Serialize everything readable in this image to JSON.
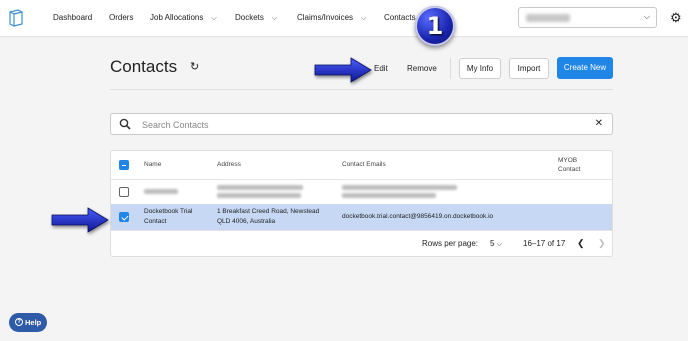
{
  "header": {
    "nav": [
      {
        "label": "Dashboard"
      },
      {
        "label": "Orders"
      },
      {
        "label": "Job Allocations"
      },
      {
        "label": "Dockets"
      },
      {
        "label": "Claims/Invoices"
      },
      {
        "label": "Contacts"
      }
    ],
    "business_select": {
      "value": "Plus Business"
    }
  },
  "annotation": {
    "step_number": "1"
  },
  "page": {
    "title": "Contacts",
    "actions": {
      "edit": "Edit",
      "remove": "Remove",
      "my_info": "My Info",
      "import": "Import",
      "create_new": "Create New"
    }
  },
  "search": {
    "placeholder": "Search Contacts",
    "value": ""
  },
  "table": {
    "columns": {
      "name": "Name",
      "address": "Address",
      "emails": "Contact Emails",
      "myob_line1": "MYOB",
      "myob_line2": "Contact"
    },
    "rows": [
      {
        "selected": false,
        "name": "Blurred contact",
        "address": "Blurred address",
        "email": "Blurred email"
      },
      {
        "selected": true,
        "name_line1": "Docketbook Trial",
        "name_line2": "Contact",
        "address_line1": "1 Breakfast Creed Road, Newstead",
        "address_line2": "QLD 4006, Australia",
        "email": "docketbook.trial.contact@9856419.on.docketbook.io"
      }
    ],
    "footer": {
      "rows_per_page_label": "Rows per page:",
      "rows_per_page_value": "5",
      "range": "16–17 of 17"
    }
  },
  "help": {
    "label": "Help"
  },
  "colors": {
    "primary": "#1f86e8",
    "selected_row": "#c6d8f3",
    "arrow_blue": "#1a2bb8",
    "help_button": "#2f5aa8"
  }
}
